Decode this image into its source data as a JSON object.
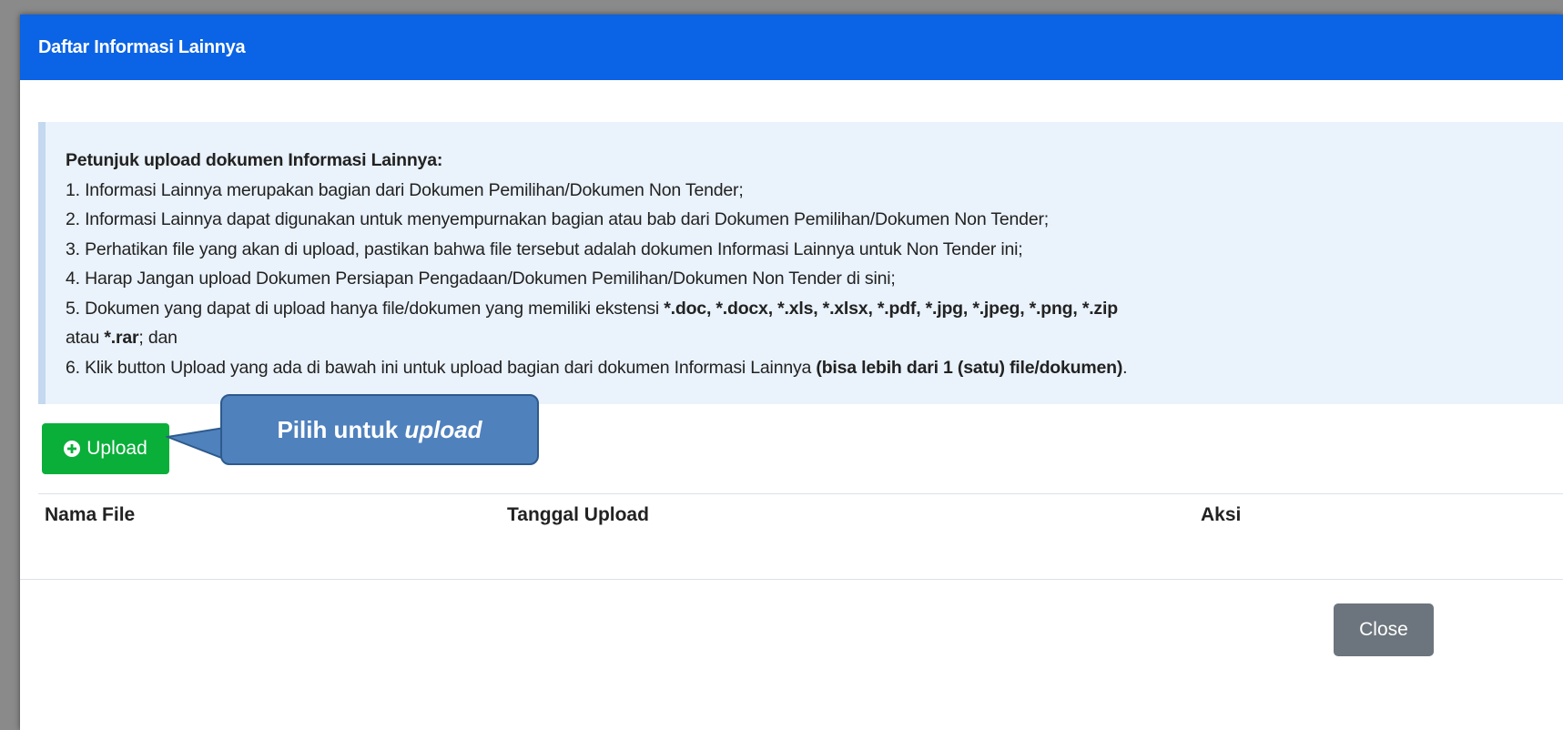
{
  "modal": {
    "title": "Daftar Informasi Lainnya",
    "header_color": "#0b63e5"
  },
  "instructions": {
    "heading": "Petunjuk upload dokumen Informasi Lainnya:",
    "item1": "1. Informasi Lainnya merupakan bagian dari Dokumen Pemilihan/Dokumen Non Tender;",
    "item2": "2. Informasi Lainnya dapat digunakan untuk menyempurnakan bagian atau bab dari Dokumen Pemilihan/Dokumen Non Tender;",
    "item3": "3. Perhatikan file yang akan di upload, pastikan bahwa file tersebut adalah dokumen Informasi Lainnya untuk Non Tender ini;",
    "item4": "4. Harap Jangan upload Dokumen Persiapan Pengadaan/Dokumen Pemilihan/Dokumen Non Tender di sini;",
    "item5_prefix": "5. Dokumen yang dapat di upload hanya file/dokumen yang memiliki ekstensi ",
    "item5_extensions": "*.doc, *.docx, *.xls, *.xlsx, *.pdf, *.jpg, *.jpeg, *.png, *.zip",
    "item5_line2_prefix": "atau ",
    "item5_rar": "*.rar",
    "item5_suffix": "; dan",
    "item6_prefix": "6. Klik button Upload yang ada di bawah ini untuk upload bagian dari dokumen Informasi Lainnya ",
    "item6_bold": "(bisa lebih dari 1 (satu) file/dokumen)",
    "item6_suffix": "."
  },
  "upload_button": {
    "label": "Upload",
    "icon": "plus-circle-icon",
    "color": "#0aaf3a"
  },
  "callout": {
    "text": "Pilih untuk",
    "text_italic": "upload",
    "color": "#4f81bd"
  },
  "table": {
    "columns": [
      "Nama File",
      "Tanggal Upload",
      "Aksi"
    ]
  },
  "close_button": {
    "label": "Close"
  }
}
